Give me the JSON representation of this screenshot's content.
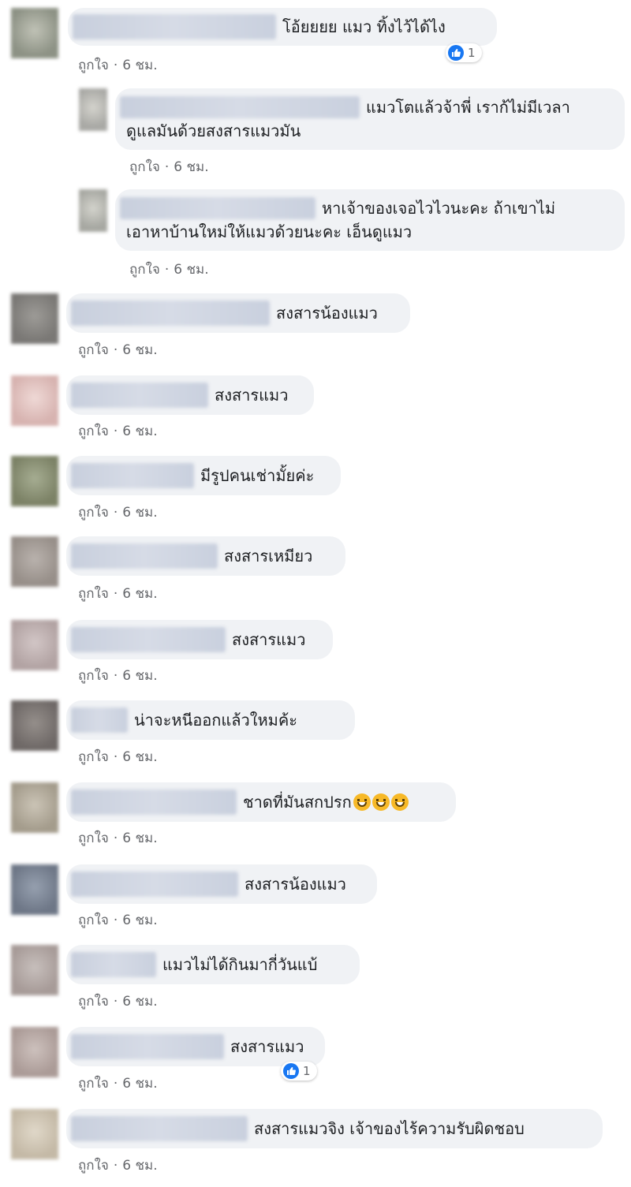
{
  "meta": {
    "like": "ถูกใจ",
    "sep": "·",
    "time": "6 ชม."
  },
  "colors": {
    "bubble": "#f0f2f5",
    "meta_text": "#65676b",
    "like_blue": "#1877f2"
  },
  "comments": [
    {
      "text": "โอ้ยยยย แมว ทิ้งไว้ได้ไง",
      "reaction_icon": "like-icon",
      "reaction_count": "1"
    },
    {
      "text": "แมวโตแล้วจ้าพี่ เราก้ไม่มีเวลา",
      "text2": "ดูแลมันด้วยสงสารแมวมัน"
    },
    {
      "text": "หาเจ้าของเจอไวไวนะคะ ถ้าเขาไม่",
      "text2": "เอาหาบ้านใหม่ให้แมวด้วยนะคะ เอ็นดูแมว"
    },
    {
      "text": "สงสารน้องแมว"
    },
    {
      "text": "สงสารแมว"
    },
    {
      "text": "มีรูปคนเช่ามั้ยค่ะ"
    },
    {
      "text": "สงสารเหมียว"
    },
    {
      "text": "สงสารแมว"
    },
    {
      "text": "น่าจะหนีออกแล้วใหมค้ะ"
    },
    {
      "text": "ชาดที่มันสกปรก",
      "emojis": [
        "grinning-face-icon",
        "grinning-face-icon",
        "grinning-face-icon"
      ]
    },
    {
      "text": "สงสารน้องแมว"
    },
    {
      "text": "แมวไม่ได้กินมากี่วันแบ้"
    },
    {
      "text": "สงสารแมว",
      "reaction_icon": "like-icon",
      "reaction_count": "1"
    },
    {
      "text": "สงสารแมวจิง เจ้าของไร้ความรับผิดชอบ"
    }
  ]
}
